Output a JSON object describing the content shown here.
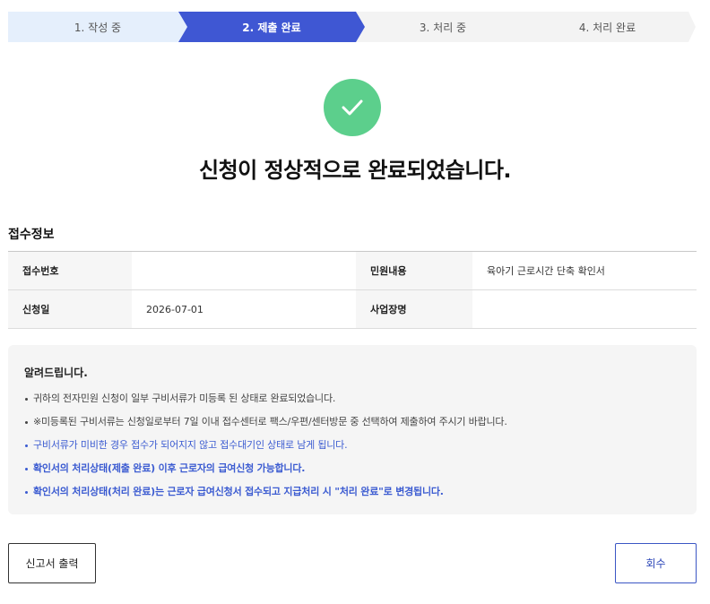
{
  "stepper": {
    "steps": [
      {
        "label": "1. 작성 중",
        "state": "done"
      },
      {
        "label": "2. 제출 완료",
        "state": "active"
      },
      {
        "label": "3. 처리 중",
        "state": "pending"
      },
      {
        "label": "4. 처리 완료",
        "state": "pending"
      }
    ],
    "colors": {
      "done": "#e5effc",
      "active": "#3f57d3",
      "pending": "#f3f3f3"
    }
  },
  "result": {
    "icon": "check-icon",
    "icon_color": "#5ccf8c",
    "title": "신청이 정상적으로 완료되었습니다."
  },
  "receipt": {
    "title": "접수정보",
    "rows": [
      {
        "label1": "접수번호",
        "value1": "",
        "label2": "민원내용",
        "value2": "육아기 근로시간 단축 확인서"
      },
      {
        "label1": "신청일",
        "value1": "2026-07-01",
        "label2": "사업장명",
        "value2": ""
      }
    ]
  },
  "notice": {
    "title": "알려드립니다.",
    "items": [
      "귀하의 전자민원 신청이 일부 구비서류가 미등록 된 상태로 완료되었습니다.",
      "※미등록된 구비서류는 신청일로부터 7일 이내 접수센터로 팩스/우편/센터방문 중 선택하여 제출하여 주시기 바랍니다.",
      "구비서류가 미비한 경우 접수가 되어지지 않고 접수대기인 상태로 남게 됩니다.",
      "확인서의 처리상태(제출 완료) 이후 근로자의 급여신청 가능합니다.",
      "확인서의 처리상태(처리 완료)는 근로자 급여신청서 접수되고 지급처리 시 \"처리 완료\"로 변경됩니다."
    ],
    "accent_color": "#3b5bd1"
  },
  "actions": {
    "print_label": "신고서 출력",
    "withdraw_label": "회수"
  }
}
